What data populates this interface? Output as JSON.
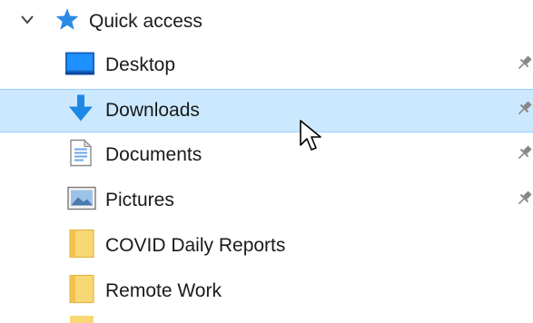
{
  "quick_access": {
    "label": "Quick access",
    "icon": "star-icon",
    "expanded": true
  },
  "items": [
    {
      "label": "Desktop",
      "icon": "desktop-icon",
      "pinned": true,
      "selected": false
    },
    {
      "label": "Downloads",
      "icon": "download-arrow-icon",
      "pinned": true,
      "selected": true
    },
    {
      "label": "Documents",
      "icon": "document-icon",
      "pinned": true,
      "selected": false
    },
    {
      "label": "Pictures",
      "icon": "pictures-icon",
      "pinned": true,
      "selected": false
    },
    {
      "label": "COVID Daily Reports",
      "icon": "folder-icon",
      "pinned": false,
      "selected": false
    },
    {
      "label": "Remote Work",
      "icon": "folder-icon",
      "pinned": false,
      "selected": false
    }
  ],
  "colors": {
    "selection_bg": "#cce8ff",
    "selection_border": "#99d1ff",
    "accent_blue": "#1e88e5",
    "folder_yellow": "#f8d775"
  }
}
